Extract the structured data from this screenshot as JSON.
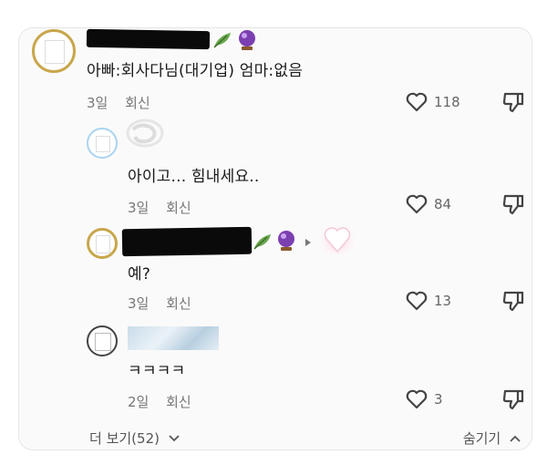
{
  "comments": [
    {
      "text": "아빠:회사다님(대기업) 엄마:없음",
      "time": "3일",
      "reply": "회신",
      "likes": "118",
      "badges": [
        "leaf-icon",
        "crystal-ball-icon"
      ]
    },
    {
      "text": "아이고... 힘내세요..",
      "time": "3일",
      "reply": "회신",
      "likes": "84"
    },
    {
      "text": "예?",
      "time": "3일",
      "reply": "회신",
      "likes": "13",
      "badges": [
        "leaf-icon",
        "crystal-ball-icon",
        "heart-icon"
      ]
    },
    {
      "text": "ㅋㅋㅋㅋ",
      "time": "2일",
      "reply": "회신",
      "likes": "3"
    }
  ],
  "footer": {
    "more": "더 보기(52)",
    "hide": "숨기기"
  },
  "colors": {
    "avatar_border_gold": "#c8a64b",
    "avatar_border_blue": "#a9d4ef",
    "muted_text": "#777777"
  }
}
